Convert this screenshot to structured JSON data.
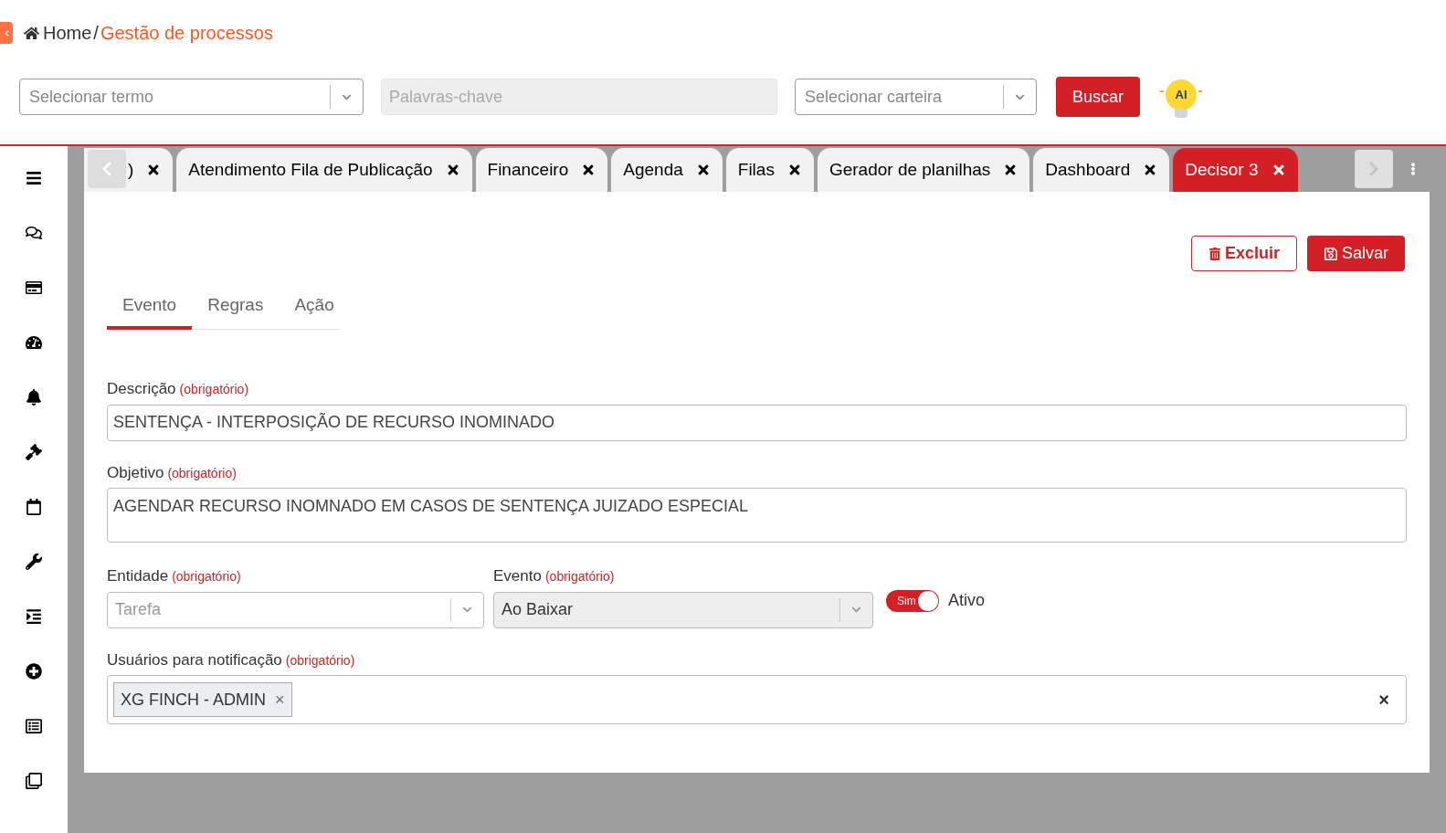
{
  "breadcrumb": {
    "home": "Home",
    "separator": "/",
    "current": "Gestão de processos"
  },
  "filters": {
    "term_placeholder": "Selecionar termo",
    "keywords_placeholder": "Palavras-chave",
    "wallet_placeholder": "Selecionar carteira",
    "search_button": "Buscar",
    "ai_badge": "AI"
  },
  "tabs": [
    {
      "label": ")",
      "selected": false
    },
    {
      "label": "Atendimento Fila de Publicação",
      "selected": false
    },
    {
      "label": "Financeiro",
      "selected": false
    },
    {
      "label": "Agenda",
      "selected": false
    },
    {
      "label": "Filas",
      "selected": false
    },
    {
      "label": "Gerador de planilhas",
      "selected": false
    },
    {
      "label": "Dashboard",
      "selected": false
    },
    {
      "label": "Decisor 3",
      "selected": true
    }
  ],
  "actions": {
    "delete": "Excluir",
    "save": "Salvar"
  },
  "form_tabs": [
    {
      "label": "Evento",
      "selected": true
    },
    {
      "label": "Regras",
      "selected": false
    },
    {
      "label": "Ação",
      "selected": false
    }
  ],
  "description": {
    "label": "Descrição",
    "required": "(obrigatório)",
    "value": "SENTENÇA - INTERPOSIÇÃO DE RECURSO INOMINADO"
  },
  "objective": {
    "label": "Objetivo",
    "required": "(obrigatório)",
    "value": "AGENDAR RECURSO INOMNADO EM CASOS DE SENTENÇA JUIZADO ESPECIAL"
  },
  "entity": {
    "label": "Entidade",
    "required": "(obrigatório)",
    "placeholder": "Tarefa"
  },
  "event": {
    "label": "Evento",
    "required": "(obrigatório)",
    "value": "Ao Baixar"
  },
  "active": {
    "on": true,
    "on_label": "Sim",
    "label": "Ativo"
  },
  "users": {
    "label": "Usuários para notificação",
    "required": "(obrigatório)",
    "tags": [
      "XG FINCH - ADMIN"
    ],
    "tag_remove": "×",
    "clear": "×"
  }
}
